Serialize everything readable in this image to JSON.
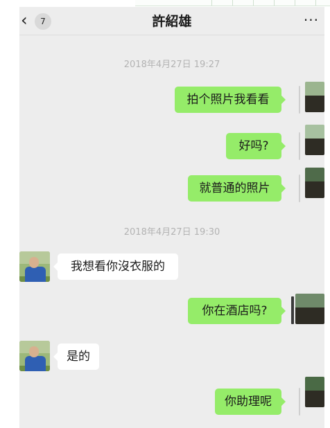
{
  "header": {
    "back_icon": "chevron-left-icon",
    "unread_count": "7",
    "title": "許紹雄",
    "more_label": "···"
  },
  "timestamps": [
    "2018年4月27日 19:27",
    "2018年4月27日 19:30"
  ],
  "messages": [
    {
      "side": "out",
      "text": "拍个照片我看看"
    },
    {
      "side": "out",
      "text": "好吗?"
    },
    {
      "side": "out",
      "text": "就普通的照片"
    },
    {
      "side": "in",
      "text": "我想看你沒衣服的"
    },
    {
      "side": "out",
      "text": "你在酒店吗?"
    },
    {
      "side": "in",
      "text": "是的"
    },
    {
      "side": "out",
      "text": "你助理呢"
    }
  ],
  "colors": {
    "outgoing_bubble": "#95ec69",
    "incoming_bubble": "#ffffff",
    "chat_background": "#ededed",
    "timestamp_text": "#b3b3b3"
  }
}
